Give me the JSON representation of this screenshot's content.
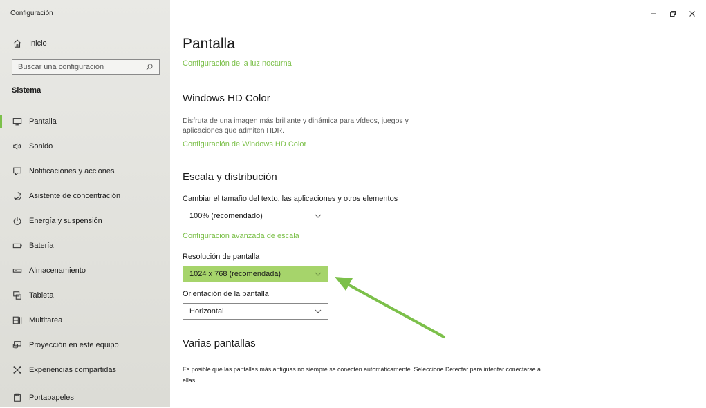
{
  "window": {
    "app_title": "Configuración",
    "controls": [
      "minimize-icon",
      "restore-icon",
      "close-icon"
    ]
  },
  "sidebar": {
    "home_label": "Inicio",
    "search": {
      "placeholder": "Buscar una configuración",
      "value": ""
    },
    "section_title": "Sistema",
    "items": [
      {
        "label": "Pantalla",
        "icon": "monitor-icon",
        "active": true
      },
      {
        "label": "Sonido",
        "icon": "speaker-icon",
        "active": false
      },
      {
        "label": "Notificaciones y acciones",
        "icon": "notification-icon",
        "active": false
      },
      {
        "label": "Asistente de concentración",
        "icon": "moon-icon",
        "active": false
      },
      {
        "label": "Energía y suspensión",
        "icon": "power-icon",
        "active": false
      },
      {
        "label": "Batería",
        "icon": "battery-icon",
        "active": false
      },
      {
        "label": "Almacenamiento",
        "icon": "storage-icon",
        "active": false
      },
      {
        "label": "Tableta",
        "icon": "tablet-icon",
        "active": false
      },
      {
        "label": "Multitarea",
        "icon": "multitask-icon",
        "active": false
      },
      {
        "label": "Proyección en este equipo",
        "icon": "projection-icon",
        "active": false
      },
      {
        "label": "Experiencias compartidas",
        "icon": "shared-icon",
        "active": false
      },
      {
        "label": "Portapapeles",
        "icon": "clipboard-icon",
        "active": false
      }
    ]
  },
  "main": {
    "title": "Pantalla",
    "night_light_link": "Configuración de la luz nocturna",
    "hd_color": {
      "heading": "Windows HD Color",
      "description": "Disfruta de una imagen más brillante y dinámica para vídeos, juegos y aplicaciones que admiten HDR.",
      "link": "Configuración de Windows HD Color"
    },
    "scale": {
      "heading": "Escala y distribución",
      "size_label": "Cambiar el tamaño del texto, las aplicaciones y otros elementos",
      "size_value": "100% (recomendado)",
      "advanced_link": "Configuración avanzada de escala",
      "resolution_label": "Resolución de pantalla",
      "resolution_value": "1024 x 768 (recomendada)",
      "orientation_label": "Orientación de la pantalla",
      "orientation_value": "Horizontal"
    },
    "multi": {
      "heading": "Varias pantallas",
      "description": "Es posible que las pantallas más antiguas no siempre se conecten automáticamente. Seleccione Detectar para intentar conectarse a ellas."
    }
  },
  "colors": {
    "accent": "#7cc04a",
    "highlight": "#a6d46b",
    "sidebar_bg": "#e3e3de"
  }
}
